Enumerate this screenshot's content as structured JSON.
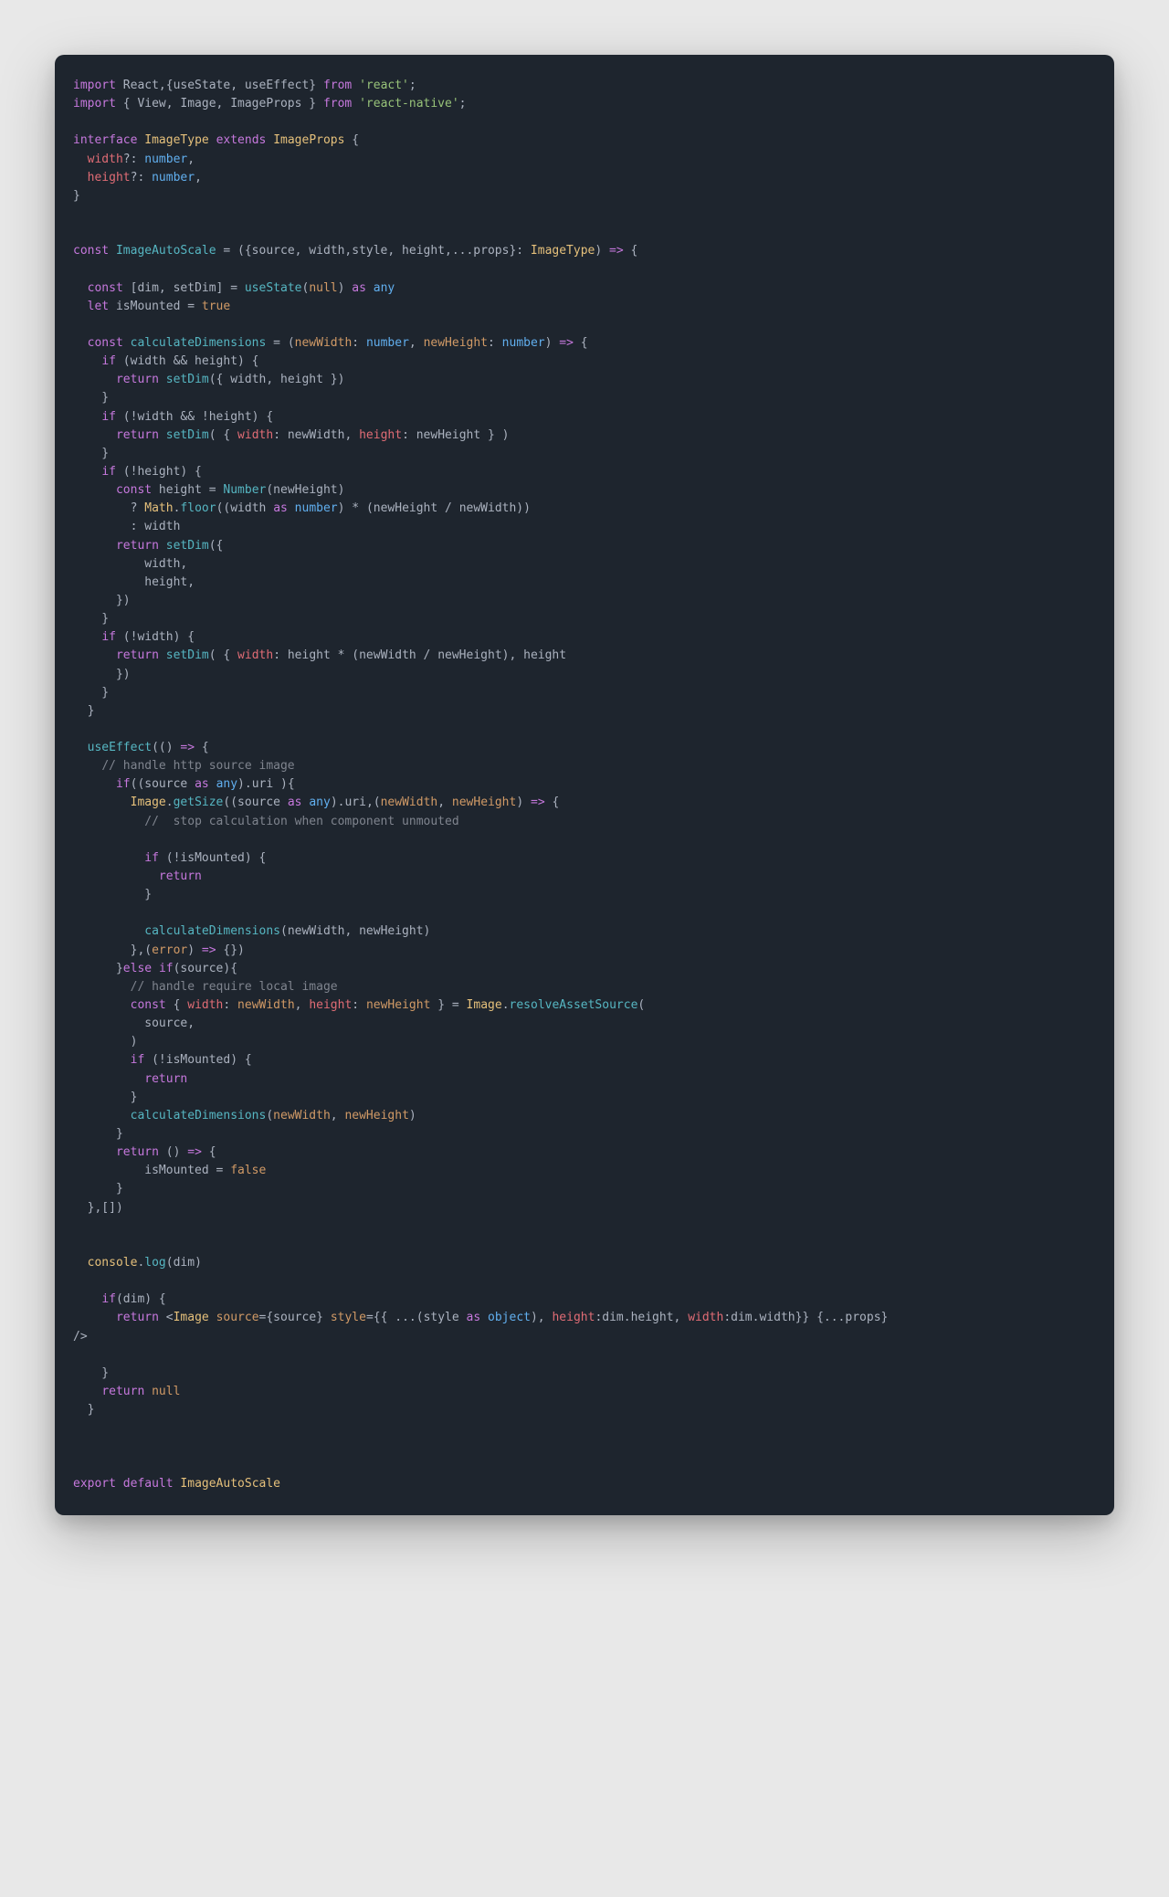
{
  "code": {
    "lines": [
      [
        {
          "c": "kw",
          "t": "import"
        },
        {
          "c": "id",
          "t": " React,{useState, useEffect} "
        },
        {
          "c": "kw",
          "t": "from"
        },
        {
          "c": "id",
          "t": " "
        },
        {
          "c": "str",
          "t": "'react'"
        },
        {
          "c": "pun",
          "t": ";"
        }
      ],
      [
        {
          "c": "kw",
          "t": "import"
        },
        {
          "c": "id",
          "t": " { View, Image, ImageProps } "
        },
        {
          "c": "kw",
          "t": "from"
        },
        {
          "c": "id",
          "t": " "
        },
        {
          "c": "str",
          "t": "'react-native'"
        },
        {
          "c": "pun",
          "t": ";"
        }
      ],
      [],
      [
        {
          "c": "kw",
          "t": "interface"
        },
        {
          "c": "id",
          "t": " "
        },
        {
          "c": "cls",
          "t": "ImageType"
        },
        {
          "c": "id",
          "t": " "
        },
        {
          "c": "kw",
          "t": "extends"
        },
        {
          "c": "id",
          "t": " "
        },
        {
          "c": "cls",
          "t": "ImageProps"
        },
        {
          "c": "id",
          "t": " {"
        }
      ],
      [
        {
          "c": "id",
          "t": "  "
        },
        {
          "c": "prop",
          "t": "width"
        },
        {
          "c": "id",
          "t": "?: "
        },
        {
          "c": "type",
          "t": "number"
        },
        {
          "c": "pun",
          "t": ","
        }
      ],
      [
        {
          "c": "id",
          "t": "  "
        },
        {
          "c": "prop",
          "t": "height"
        },
        {
          "c": "id",
          "t": "?: "
        },
        {
          "c": "type",
          "t": "number"
        },
        {
          "c": "pun",
          "t": ","
        }
      ],
      [
        {
          "c": "pun",
          "t": "}"
        }
      ],
      [],
      [],
      [
        {
          "c": "kw",
          "t": "const"
        },
        {
          "c": "id",
          "t": " "
        },
        {
          "c": "fn",
          "t": "ImageAutoScale"
        },
        {
          "c": "id",
          "t": " = ({source, width,style, height,...props}: "
        },
        {
          "c": "cls",
          "t": "ImageType"
        },
        {
          "c": "id",
          "t": ") "
        },
        {
          "c": "kw",
          "t": "=>"
        },
        {
          "c": "id",
          "t": " {"
        }
      ],
      [],
      [
        {
          "c": "id",
          "t": "  "
        },
        {
          "c": "kw",
          "t": "const"
        },
        {
          "c": "id",
          "t": " [dim, setDim] = "
        },
        {
          "c": "fn",
          "t": "useState"
        },
        {
          "c": "id",
          "t": "("
        },
        {
          "c": "num",
          "t": "null"
        },
        {
          "c": "id",
          "t": ") "
        },
        {
          "c": "kw",
          "t": "as"
        },
        {
          "c": "id",
          "t": " "
        },
        {
          "c": "type",
          "t": "any"
        }
      ],
      [
        {
          "c": "id",
          "t": "  "
        },
        {
          "c": "kw",
          "t": "let"
        },
        {
          "c": "id",
          "t": " isMounted = "
        },
        {
          "c": "num",
          "t": "true"
        }
      ],
      [],
      [
        {
          "c": "id",
          "t": "  "
        },
        {
          "c": "kw",
          "t": "const"
        },
        {
          "c": "id",
          "t": " "
        },
        {
          "c": "fn",
          "t": "calculateDimensions"
        },
        {
          "c": "id",
          "t": " = ("
        },
        {
          "c": "param",
          "t": "newWidth"
        },
        {
          "c": "id",
          "t": ": "
        },
        {
          "c": "type",
          "t": "number"
        },
        {
          "c": "id",
          "t": ", "
        },
        {
          "c": "param",
          "t": "newHeight"
        },
        {
          "c": "id",
          "t": ": "
        },
        {
          "c": "type",
          "t": "number"
        },
        {
          "c": "id",
          "t": ") "
        },
        {
          "c": "kw",
          "t": "=>"
        },
        {
          "c": "id",
          "t": " {"
        }
      ],
      [
        {
          "c": "id",
          "t": "    "
        },
        {
          "c": "kw",
          "t": "if"
        },
        {
          "c": "id",
          "t": " (width && height) {"
        }
      ],
      [
        {
          "c": "id",
          "t": "      "
        },
        {
          "c": "kw",
          "t": "return"
        },
        {
          "c": "id",
          "t": " "
        },
        {
          "c": "fn",
          "t": "setDim"
        },
        {
          "c": "id",
          "t": "({ width, height })"
        }
      ],
      [
        {
          "c": "id",
          "t": "    }"
        }
      ],
      [
        {
          "c": "id",
          "t": "    "
        },
        {
          "c": "kw",
          "t": "if"
        },
        {
          "c": "id",
          "t": " (!width && !height) {"
        }
      ],
      [
        {
          "c": "id",
          "t": "      "
        },
        {
          "c": "kw",
          "t": "return"
        },
        {
          "c": "id",
          "t": " "
        },
        {
          "c": "fn",
          "t": "setDim"
        },
        {
          "c": "id",
          "t": "( { "
        },
        {
          "c": "prop",
          "t": "width"
        },
        {
          "c": "id",
          "t": ": newWidth, "
        },
        {
          "c": "prop",
          "t": "height"
        },
        {
          "c": "id",
          "t": ": newHeight } )"
        }
      ],
      [
        {
          "c": "id",
          "t": "    }"
        }
      ],
      [
        {
          "c": "id",
          "t": "    "
        },
        {
          "c": "kw",
          "t": "if"
        },
        {
          "c": "id",
          "t": " (!height) {"
        }
      ],
      [
        {
          "c": "id",
          "t": "      "
        },
        {
          "c": "kw",
          "t": "const"
        },
        {
          "c": "id",
          "t": " height = "
        },
        {
          "c": "fn",
          "t": "Number"
        },
        {
          "c": "id",
          "t": "(newHeight)"
        }
      ],
      [
        {
          "c": "id",
          "t": "        ? "
        },
        {
          "c": "cls",
          "t": "Math"
        },
        {
          "c": "id",
          "t": "."
        },
        {
          "c": "fn",
          "t": "floor"
        },
        {
          "c": "id",
          "t": "((width "
        },
        {
          "c": "kw",
          "t": "as"
        },
        {
          "c": "id",
          "t": " "
        },
        {
          "c": "type",
          "t": "number"
        },
        {
          "c": "id",
          "t": ") * (newHeight / newWidth))"
        }
      ],
      [
        {
          "c": "id",
          "t": "        : width"
        }
      ],
      [
        {
          "c": "id",
          "t": "      "
        },
        {
          "c": "kw",
          "t": "return"
        },
        {
          "c": "id",
          "t": " "
        },
        {
          "c": "fn",
          "t": "setDim"
        },
        {
          "c": "id",
          "t": "({"
        }
      ],
      [
        {
          "c": "id",
          "t": "          width,"
        }
      ],
      [
        {
          "c": "id",
          "t": "          height,"
        }
      ],
      [
        {
          "c": "id",
          "t": "      })"
        }
      ],
      [
        {
          "c": "id",
          "t": "    }"
        }
      ],
      [
        {
          "c": "id",
          "t": "    "
        },
        {
          "c": "kw",
          "t": "if"
        },
        {
          "c": "id",
          "t": " (!width) {"
        }
      ],
      [
        {
          "c": "id",
          "t": "      "
        },
        {
          "c": "kw",
          "t": "return"
        },
        {
          "c": "id",
          "t": " "
        },
        {
          "c": "fn",
          "t": "setDim"
        },
        {
          "c": "id",
          "t": "( { "
        },
        {
          "c": "prop",
          "t": "width"
        },
        {
          "c": "id",
          "t": ": height * (newWidth / newHeight), height"
        }
      ],
      [
        {
          "c": "id",
          "t": "      })"
        }
      ],
      [
        {
          "c": "id",
          "t": "    }"
        }
      ],
      [
        {
          "c": "id",
          "t": "  }"
        }
      ],
      [],
      [
        {
          "c": "id",
          "t": "  "
        },
        {
          "c": "fn",
          "t": "useEffect"
        },
        {
          "c": "id",
          "t": "(() "
        },
        {
          "c": "kw",
          "t": "=>"
        },
        {
          "c": "id",
          "t": " {"
        }
      ],
      [
        {
          "c": "id",
          "t": "    "
        },
        {
          "c": "com",
          "t": "// handle http source image"
        }
      ],
      [
        {
          "c": "id",
          "t": "      "
        },
        {
          "c": "kw",
          "t": "if"
        },
        {
          "c": "id",
          "t": "((source "
        },
        {
          "c": "kw",
          "t": "as"
        },
        {
          "c": "id",
          "t": " "
        },
        {
          "c": "type",
          "t": "any"
        },
        {
          "c": "id",
          "t": ").uri ){"
        }
      ],
      [
        {
          "c": "id",
          "t": "        "
        },
        {
          "c": "cls",
          "t": "Image"
        },
        {
          "c": "id",
          "t": "."
        },
        {
          "c": "fn",
          "t": "getSize"
        },
        {
          "c": "id",
          "t": "((source "
        },
        {
          "c": "kw",
          "t": "as"
        },
        {
          "c": "id",
          "t": " "
        },
        {
          "c": "type",
          "t": "any"
        },
        {
          "c": "id",
          "t": ").uri,("
        },
        {
          "c": "param",
          "t": "newWidth"
        },
        {
          "c": "id",
          "t": ", "
        },
        {
          "c": "param",
          "t": "newHeight"
        },
        {
          "c": "id",
          "t": ") "
        },
        {
          "c": "kw",
          "t": "=>"
        },
        {
          "c": "id",
          "t": " {"
        }
      ],
      [
        {
          "c": "id",
          "t": "          "
        },
        {
          "c": "com",
          "t": "//  stop calculation when component unmouted"
        }
      ],
      [],
      [
        {
          "c": "id",
          "t": "          "
        },
        {
          "c": "kw",
          "t": "if"
        },
        {
          "c": "id",
          "t": " (!isMounted) {"
        }
      ],
      [
        {
          "c": "id",
          "t": "            "
        },
        {
          "c": "kw",
          "t": "return"
        }
      ],
      [
        {
          "c": "id",
          "t": "          }"
        }
      ],
      [],
      [
        {
          "c": "id",
          "t": "          "
        },
        {
          "c": "fn",
          "t": "calculateDimensions"
        },
        {
          "c": "id",
          "t": "(newWidth, newHeight)"
        }
      ],
      [
        {
          "c": "id",
          "t": "        },("
        },
        {
          "c": "param",
          "t": "error"
        },
        {
          "c": "id",
          "t": ") "
        },
        {
          "c": "kw",
          "t": "=>"
        },
        {
          "c": "id",
          "t": " {})"
        }
      ],
      [
        {
          "c": "id",
          "t": "      }"
        },
        {
          "c": "kw",
          "t": "else"
        },
        {
          "c": "id",
          "t": " "
        },
        {
          "c": "kw",
          "t": "if"
        },
        {
          "c": "id",
          "t": "(source){"
        }
      ],
      [
        {
          "c": "id",
          "t": "        "
        },
        {
          "c": "com",
          "t": "// handle require local image"
        }
      ],
      [
        {
          "c": "id",
          "t": "        "
        },
        {
          "c": "kw",
          "t": "const"
        },
        {
          "c": "id",
          "t": " { "
        },
        {
          "c": "prop",
          "t": "width"
        },
        {
          "c": "id",
          "t": ": "
        },
        {
          "c": "param",
          "t": "newWidth"
        },
        {
          "c": "id",
          "t": ", "
        },
        {
          "c": "prop",
          "t": "height"
        },
        {
          "c": "id",
          "t": ": "
        },
        {
          "c": "param",
          "t": "newHeight"
        },
        {
          "c": "id",
          "t": " } = "
        },
        {
          "c": "cls",
          "t": "Image"
        },
        {
          "c": "id",
          "t": "."
        },
        {
          "c": "fn",
          "t": "resolveAssetSource"
        },
        {
          "c": "id",
          "t": "("
        }
      ],
      [
        {
          "c": "id",
          "t": "          source,"
        }
      ],
      [
        {
          "c": "id",
          "t": "        )"
        }
      ],
      [
        {
          "c": "id",
          "t": "        "
        },
        {
          "c": "kw",
          "t": "if"
        },
        {
          "c": "id",
          "t": " (!isMounted) {"
        }
      ],
      [
        {
          "c": "id",
          "t": "          "
        },
        {
          "c": "kw",
          "t": "return"
        }
      ],
      [
        {
          "c": "id",
          "t": "        }"
        }
      ],
      [
        {
          "c": "id",
          "t": "        "
        },
        {
          "c": "fn",
          "t": "calculateDimensions"
        },
        {
          "c": "id",
          "t": "("
        },
        {
          "c": "param",
          "t": "newWidth"
        },
        {
          "c": "id",
          "t": ", "
        },
        {
          "c": "param",
          "t": "newHeight"
        },
        {
          "c": "id",
          "t": ")"
        }
      ],
      [
        {
          "c": "id",
          "t": "      }"
        }
      ],
      [
        {
          "c": "id",
          "t": "      "
        },
        {
          "c": "kw",
          "t": "return"
        },
        {
          "c": "id",
          "t": " () "
        },
        {
          "c": "kw",
          "t": "=>"
        },
        {
          "c": "id",
          "t": " {"
        }
      ],
      [
        {
          "c": "id",
          "t": "          isMounted = "
        },
        {
          "c": "num",
          "t": "false"
        }
      ],
      [
        {
          "c": "id",
          "t": "      }"
        }
      ],
      [
        {
          "c": "id",
          "t": "  },[])"
        }
      ],
      [],
      [],
      [
        {
          "c": "id",
          "t": "  "
        },
        {
          "c": "cls",
          "t": "console"
        },
        {
          "c": "id",
          "t": "."
        },
        {
          "c": "fn",
          "t": "log"
        },
        {
          "c": "id",
          "t": "(dim)"
        }
      ],
      [],
      [
        {
          "c": "id",
          "t": "    "
        },
        {
          "c": "kw",
          "t": "if"
        },
        {
          "c": "id",
          "t": "(dim) {"
        }
      ],
      [
        {
          "c": "id",
          "t": "      "
        },
        {
          "c": "kw",
          "t": "return"
        },
        {
          "c": "id",
          "t": " <"
        },
        {
          "c": "cls",
          "t": "Image"
        },
        {
          "c": "id",
          "t": " "
        },
        {
          "c": "param",
          "t": "source"
        },
        {
          "c": "id",
          "t": "={source} "
        },
        {
          "c": "param",
          "t": "style"
        },
        {
          "c": "id",
          "t": "={{ ...(style "
        },
        {
          "c": "kw",
          "t": "as"
        },
        {
          "c": "id",
          "t": " "
        },
        {
          "c": "type",
          "t": "object"
        },
        {
          "c": "id",
          "t": "), "
        },
        {
          "c": "prop",
          "t": "height"
        },
        {
          "c": "id",
          "t": ":dim.height, "
        },
        {
          "c": "prop",
          "t": "width"
        },
        {
          "c": "id",
          "t": ":dim.width}} {...props}"
        }
      ],
      [
        {
          "c": "id",
          "t": "/>"
        }
      ],
      [],
      [
        {
          "c": "id",
          "t": "    }"
        }
      ],
      [
        {
          "c": "id",
          "t": "    "
        },
        {
          "c": "kw",
          "t": "return"
        },
        {
          "c": "id",
          "t": " "
        },
        {
          "c": "num",
          "t": "null"
        }
      ],
      [
        {
          "c": "id",
          "t": "  }"
        }
      ],
      [],
      [],
      [],
      [
        {
          "c": "kw",
          "t": "export"
        },
        {
          "c": "id",
          "t": " "
        },
        {
          "c": "kw",
          "t": "default"
        },
        {
          "c": "id",
          "t": " "
        },
        {
          "c": "cls",
          "t": "ImageAutoScale"
        }
      ]
    ]
  }
}
